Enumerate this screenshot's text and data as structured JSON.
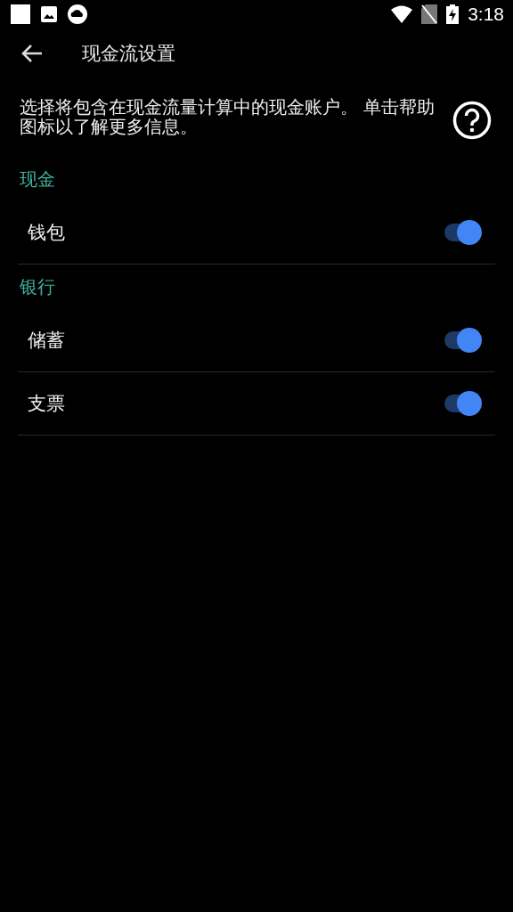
{
  "status_bar": {
    "time": "3:18"
  },
  "toolbar": {
    "title": "现金流设置"
  },
  "description": "选择将包含在现金流量计算中的现金账户。 单击帮助图标以了解更多信息。",
  "sections": [
    {
      "title": "现金",
      "items": [
        {
          "label": "钱包",
          "on": true
        }
      ]
    },
    {
      "title": "银行",
      "items": [
        {
          "label": "储蓄",
          "on": true
        },
        {
          "label": "支票",
          "on": true
        }
      ]
    }
  ]
}
